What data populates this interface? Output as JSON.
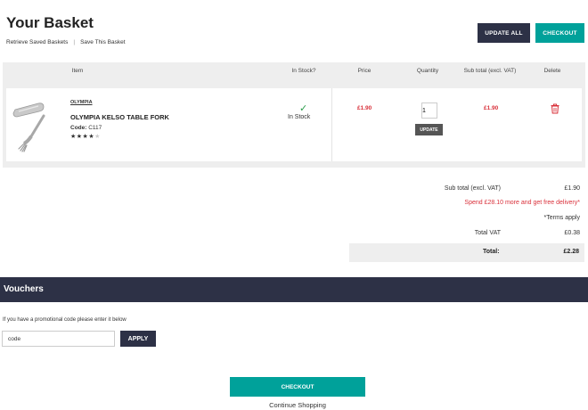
{
  "header": {
    "title": "Your Basket",
    "retrieve_label": "Retrieve Saved Baskets",
    "separator": "|",
    "save_label": "Save This Basket",
    "update_all_label": "UPDATE ALL",
    "checkout_label": "CHECKOUT"
  },
  "table": {
    "columns": [
      "Item",
      "In Stock?",
      "Price",
      "Quantity",
      "Sub total (excl. VAT)",
      "Delete"
    ],
    "rows": [
      {
        "brand": "OLYMPIA",
        "name": "OLYMPIA KELSO TABLE FORK",
        "code_label": "Code:",
        "code": "C117",
        "stars_filled": "★★★★",
        "stars_empty": "★",
        "rating": 4,
        "in_stock_icon": "check-icon",
        "in_stock": "In Stock",
        "price": "£1.90",
        "quantity": "1",
        "update_label": "UPDATE",
        "subtotal": "£1.90",
        "delete_icon": "trash-icon"
      }
    ]
  },
  "summary": {
    "subtotal_label": "Sub total (excl. VAT)",
    "subtotal_value": "£1.90",
    "delivery_note": "Spend £28.10 more and get free delivery*",
    "terms": "*Terms apply",
    "vat_label": "Total VAT",
    "vat_value": "£0.38",
    "total_label": "Total:",
    "total_value": "£2.28"
  },
  "vouchers": {
    "title": "Vouchers",
    "prompt": "If you have a promotional code please enter it below",
    "input_value": "code",
    "apply_label": "APPLY"
  },
  "footer": {
    "checkout_label": "CHECKOUT",
    "continue_label": "Continue Shopping"
  },
  "colors": {
    "navy": "#2d3146",
    "teal": "#00a19a",
    "price_red": "#d9303a",
    "stock_green": "#2a9d4a"
  }
}
